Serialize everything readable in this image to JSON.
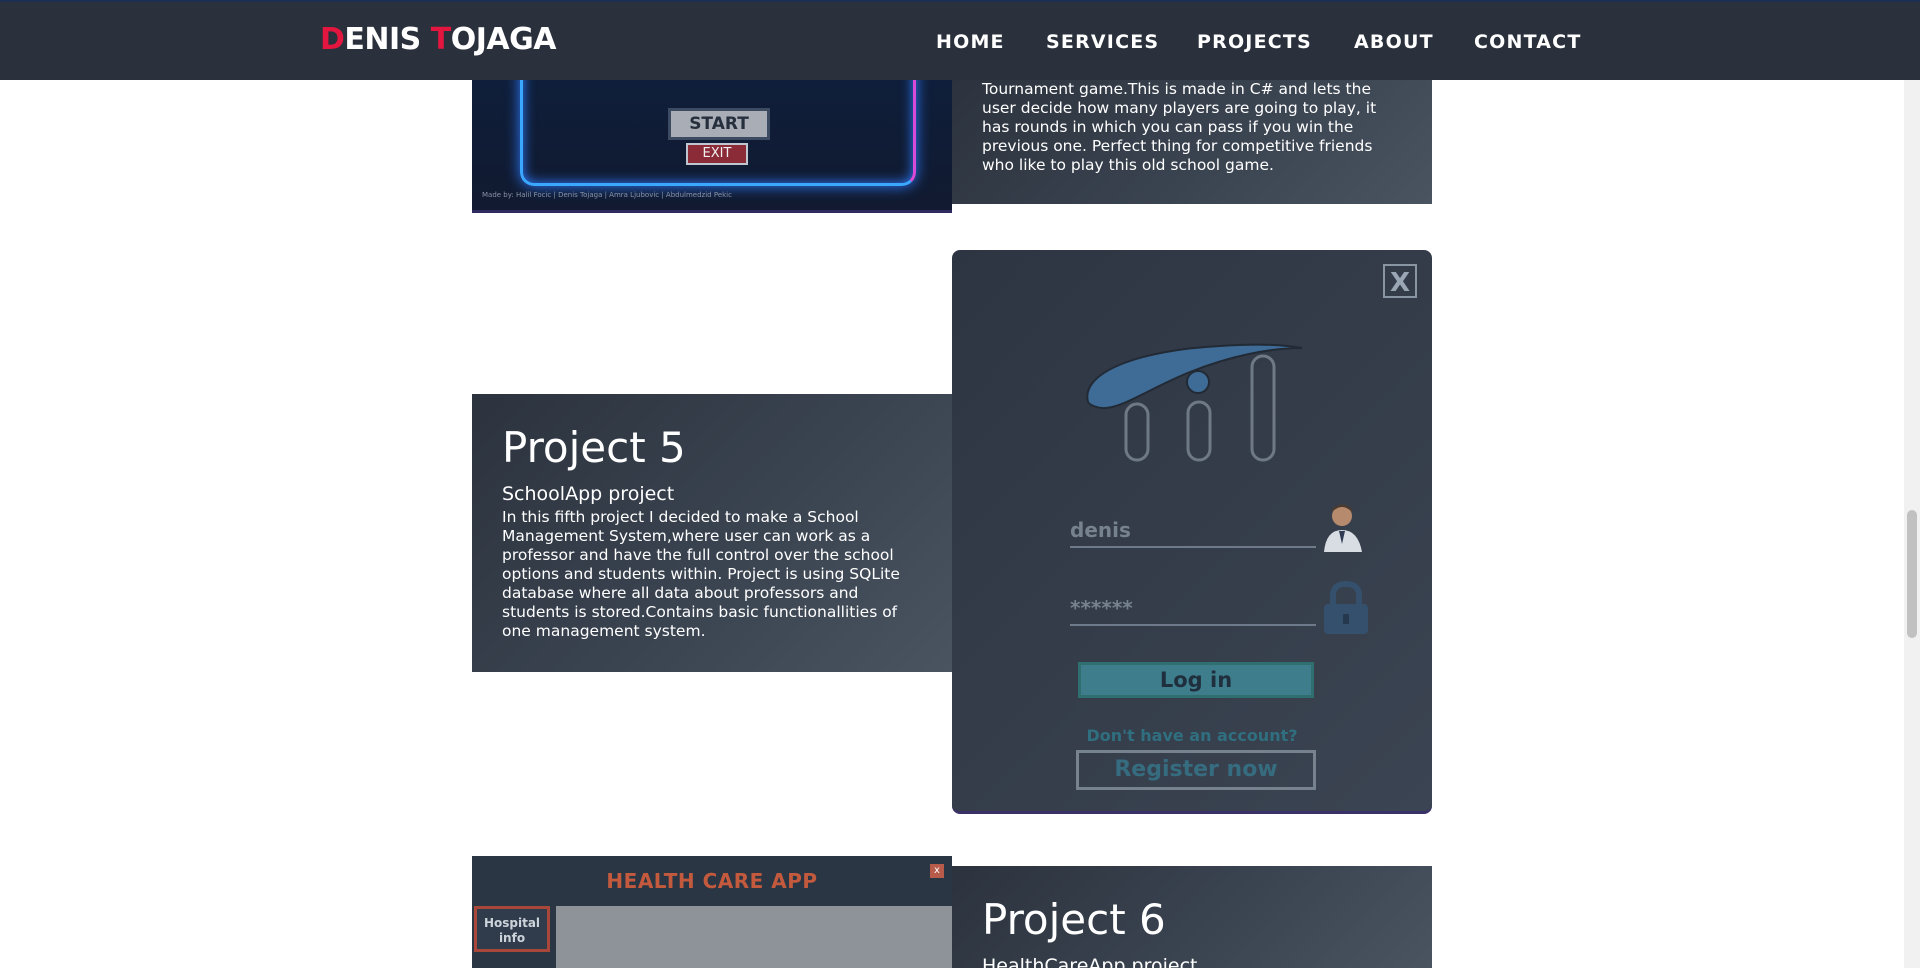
{
  "navbar": {
    "logo": {
      "d": "D",
      "enis": "ENIS ",
      "t": "T",
      "ojaga": "OJAGA"
    },
    "links": [
      "HOME",
      "SERVICES",
      "PROJECTS",
      "ABOUT",
      "CONTACT"
    ]
  },
  "colors": {
    "accent": "#e2163f",
    "navbar_bg": "#2a313c",
    "card_bg": "#3a4350"
  },
  "project4": {
    "description": "Tournament game.This is made in C# and lets the user decide how many players are going to play, it has rounds in which you can pass if you win the previous one. Perfect thing for competitive friends who like to play this old school game.",
    "screenshot": {
      "start_label": "START",
      "exit_label": "EXIT",
      "credits": "Made by: Halil Focic | Denis Tojaga | Amra Ljubovic | Abdulmedzid Pekic"
    }
  },
  "project5": {
    "title": "Project 5",
    "subtitle": "SchoolApp project",
    "description": "In this fifth project I decided to make a School Management System,where user can work as a professor and have the full control over the school options and students within. Project is using SQLite database where all data about professors and students is stored.Contains basic functionallities of one management system.",
    "screenshot": {
      "close_label": "X",
      "username_value": "denis",
      "password_value": "******",
      "login_label": "Log in",
      "no_account_text": "Don't have an account?",
      "register_label": "Register now"
    }
  },
  "project6": {
    "title": "Project 6",
    "subtitle": "HealthCareApp project",
    "screenshot": {
      "header": "HEALTH CARE APP",
      "close_label": "x",
      "sidebar_item": "Hospital info"
    }
  }
}
